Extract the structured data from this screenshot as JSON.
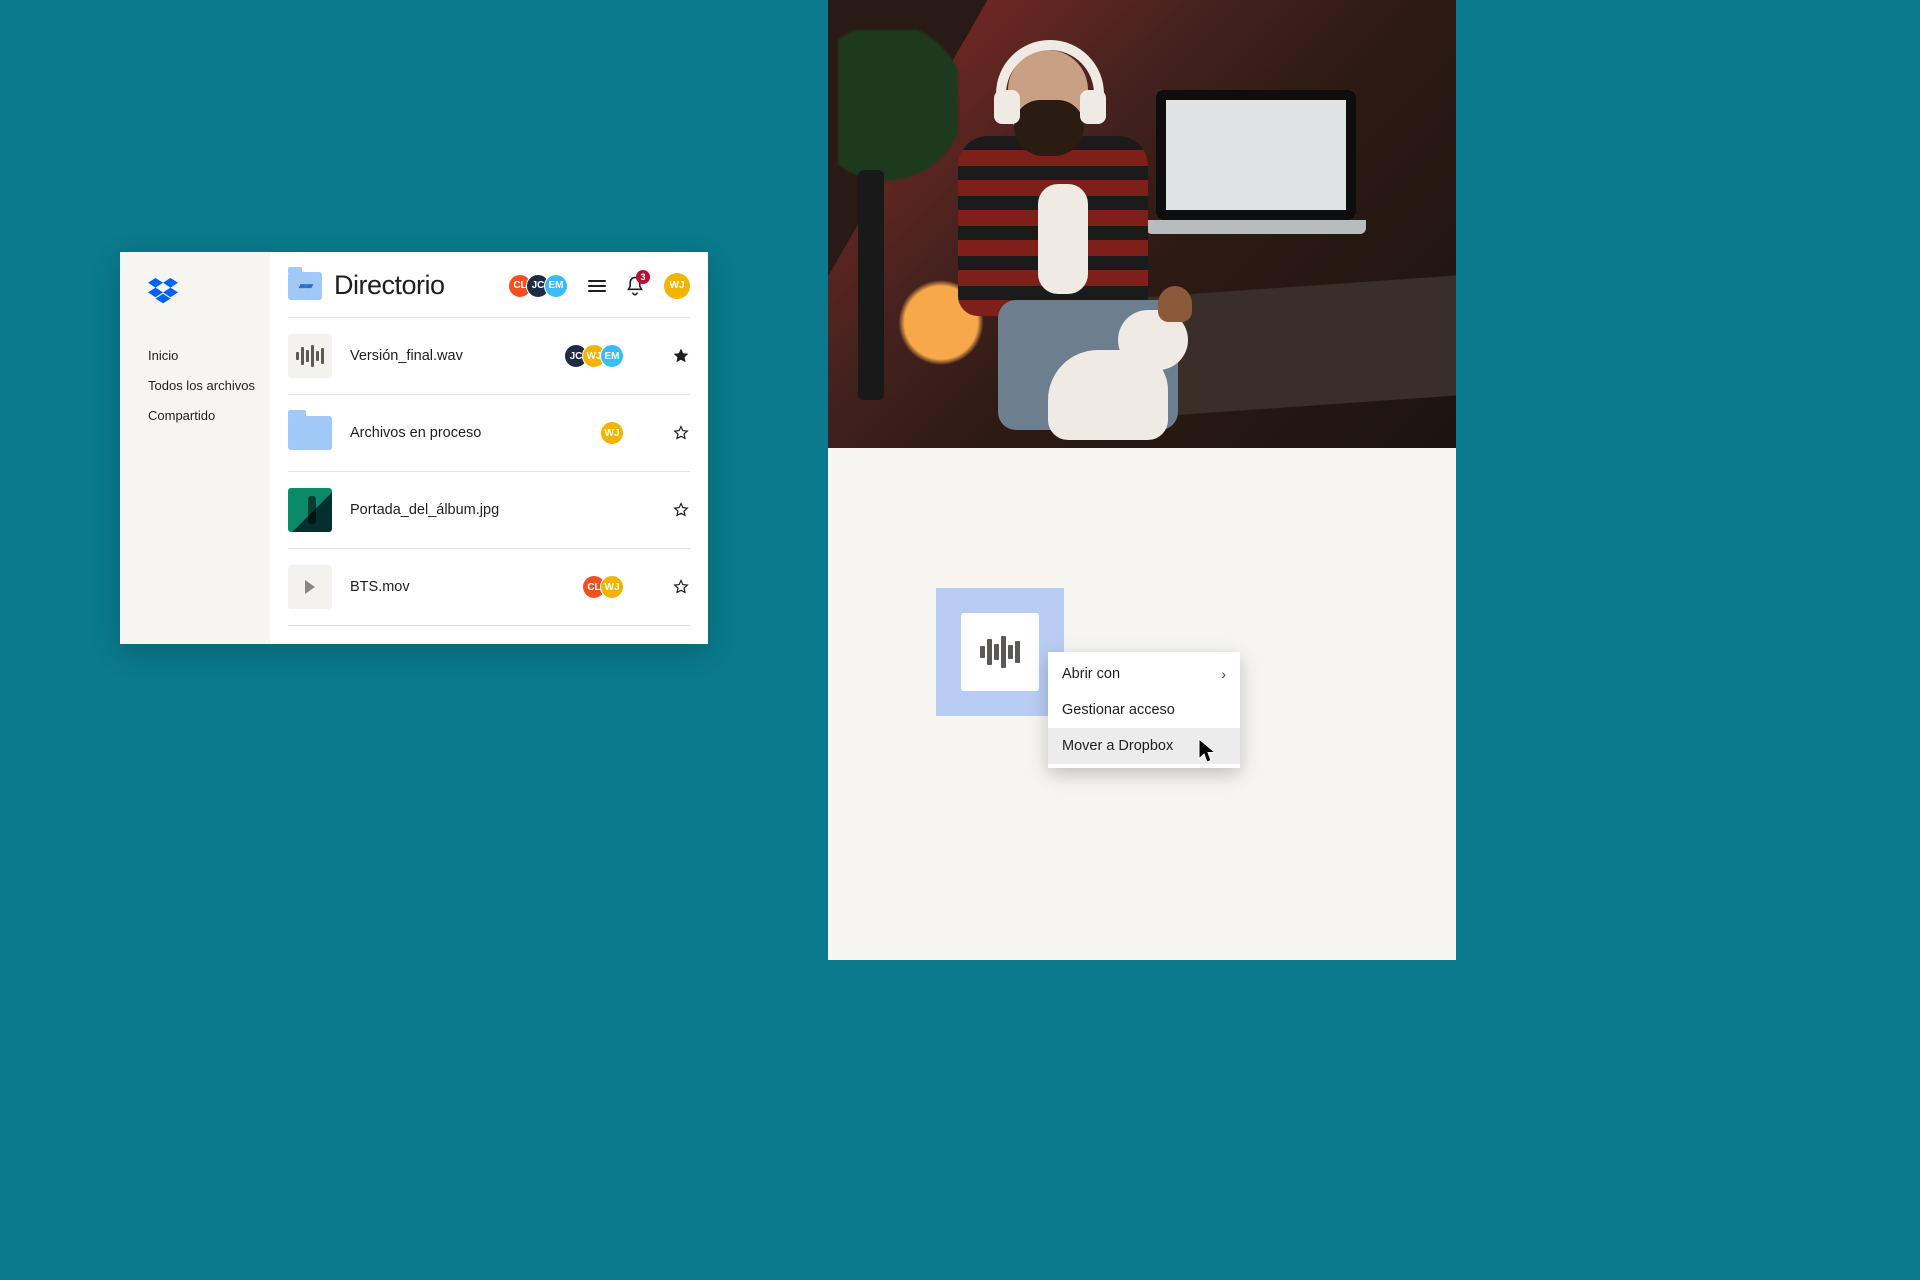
{
  "sidebar": {
    "items": [
      {
        "label": "Inicio"
      },
      {
        "label": "Todos los archivos"
      },
      {
        "label": "Compartido"
      }
    ]
  },
  "header": {
    "title": "Directorio",
    "avatars": [
      {
        "initials": "CL",
        "color": "#f25022"
      },
      {
        "initials": "JC",
        "color": "#1f2a44"
      },
      {
        "initials": "EM",
        "color": "#38bdf8"
      }
    ],
    "notification_count": "3",
    "current_user": {
      "initials": "WJ",
      "color": "#f5b301"
    }
  },
  "files": [
    {
      "name": "Versión_final.wav",
      "type": "audio",
      "starred": true,
      "collaborators": [
        {
          "initials": "JC",
          "color": "#1f2a44"
        },
        {
          "initials": "WJ",
          "color": "#f5b301"
        },
        {
          "initials": "EM",
          "color": "#38bdf8"
        }
      ]
    },
    {
      "name": "Archivos en proceso",
      "type": "folder",
      "starred": false,
      "collaborators": [
        {
          "initials": "WJ",
          "color": "#f5b301"
        }
      ]
    },
    {
      "name": "Portada_del_álbum.jpg",
      "type": "image",
      "starred": false,
      "collaborators": []
    },
    {
      "name": "BTS.mov",
      "type": "video",
      "starred": false,
      "collaborators": [
        {
          "initials": "CL",
          "color": "#f25022"
        },
        {
          "initials": "WJ",
          "color": "#f5b301"
        }
      ]
    }
  ],
  "context_menu": {
    "items": [
      {
        "label": "Abrir con",
        "has_submenu": true,
        "hovered": false
      },
      {
        "label": "Gestionar acceso",
        "has_submenu": false,
        "hovered": false
      },
      {
        "label": "Mover a Dropbox",
        "has_submenu": false,
        "hovered": true
      }
    ]
  }
}
